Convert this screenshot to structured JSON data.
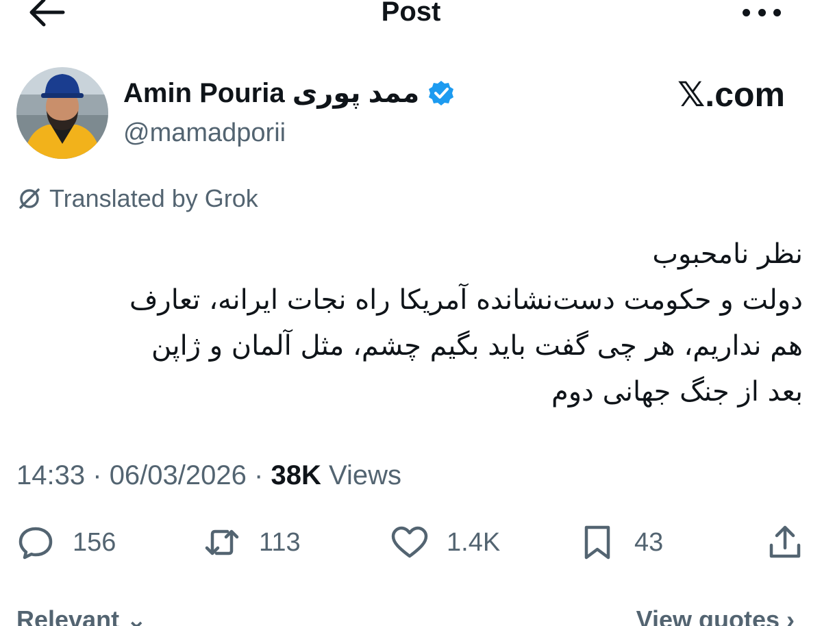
{
  "header": {
    "title": "Post",
    "back_icon": "arrow-left-icon",
    "more_icon": "more-horizontal-icon"
  },
  "author": {
    "display_name": "Amin Pouria ممد پوری",
    "handle": "@mamadporii",
    "verified": true,
    "verified_color": "#1d9bf0"
  },
  "watermark": "𝕏.com",
  "translation": {
    "label": "Translated by Grok",
    "icon": "grok-icon"
  },
  "tweet": {
    "lines": [
      "نظر نامحبوب",
      "دولت و حکومت دست‌نشانده آمریکا راه نجات ایرانه، تعارف",
      "هم نداریم، هر چی گفت باید بگیم چشم، مثل آلمان و ژاپن",
      "بعد از جنگ جهانی دوم"
    ]
  },
  "meta": {
    "time": "14:33",
    "date": "06/03/2026",
    "views_count": "38K",
    "views_label": "Views",
    "separator": "·"
  },
  "actions": {
    "replies": "156",
    "reposts": "113",
    "likes": "1.4K",
    "bookmarks": "43"
  },
  "footer": {
    "sort_label": "Relevant ⌄",
    "quotes_label": "View quotes ›"
  },
  "colors": {
    "text": "#0f1419",
    "secondary": "#536471",
    "accent": "#1d9bf0"
  }
}
